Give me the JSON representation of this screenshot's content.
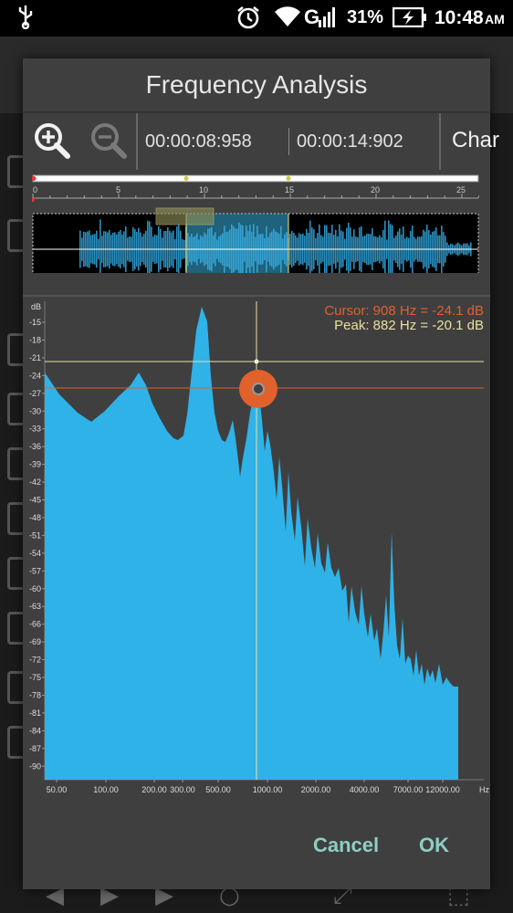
{
  "status_bar": {
    "usb_icon": "usb-icon",
    "network": "G",
    "battery": "31%",
    "time": "10:48",
    "ampm": "AM"
  },
  "dialog": {
    "title": "Frequency Analysis",
    "toolbar": {
      "zoom_in_icon": "zoom-in-icon",
      "zoom_out_icon": "zoom-out-icon",
      "start_time": "00:00:08:958",
      "end_time": "00:00:14:902",
      "channel_label": "Char"
    },
    "timeline": {
      "ticks": [
        "0",
        "5",
        "10",
        "15",
        "20",
        "25"
      ]
    },
    "spectrum": {
      "db_unit": "dB",
      "db_ticks": [
        "-15",
        "-18",
        "-21",
        "-24",
        "-27",
        "-30",
        "-33",
        "-36",
        "-39",
        "-42",
        "-45",
        "-48",
        "-51",
        "-54",
        "-57",
        "-60",
        "-63",
        "-66",
        "-69",
        "-72",
        "-75",
        "-78",
        "-81",
        "-84",
        "-87",
        "-90"
      ],
      "freq_ticks": [
        "50.00",
        "100.00",
        "200.00",
        "300.00",
        "500.00",
        "1000.00",
        "2000.00",
        "4000.00",
        "7000.00",
        "12000.00"
      ],
      "freq_unit": "Hz",
      "cursor_text": "Cursor: 908 Hz = -24.1 dB",
      "peak_text": "Peak: 882 Hz = -20.1 dB",
      "cursor_color": "#e0612b",
      "peak_color": "#e8e0a0",
      "fill_color": "#2fb2e8"
    },
    "buttons": {
      "cancel": "Cancel",
      "ok": "OK"
    }
  }
}
